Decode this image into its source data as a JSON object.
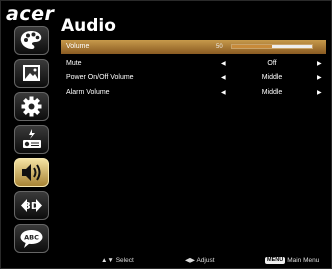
{
  "brand": {
    "logo_text": "acer"
  },
  "header": {
    "title": "Audio"
  },
  "sidebar": {
    "items": [
      {
        "icon": "palette-icon"
      },
      {
        "icon": "image-icon"
      },
      {
        "icon": "gear-icon"
      },
      {
        "icon": "projector-power-icon"
      },
      {
        "icon": "speaker-icon",
        "active": true
      },
      {
        "icon": "3d-icon"
      },
      {
        "icon": "abc-language-icon"
      }
    ]
  },
  "menu": {
    "volume": {
      "label": "Volume",
      "value": "50",
      "level_percent": 50
    },
    "mute": {
      "label": "Mute",
      "value": "Off"
    },
    "power_volume": {
      "label": "Power On/Off Volume",
      "value": "Middle"
    },
    "alarm_volume": {
      "label": "Alarm Volume",
      "value": "Middle"
    }
  },
  "footer": {
    "select_label": "Select",
    "adjust_label": "Adjust",
    "menu_key": "MENU",
    "main_menu_label": "Main Menu"
  },
  "colors": {
    "accent": "#c79a4b",
    "selected_icon_bg": "#e6cf84",
    "background": "#000000"
  }
}
